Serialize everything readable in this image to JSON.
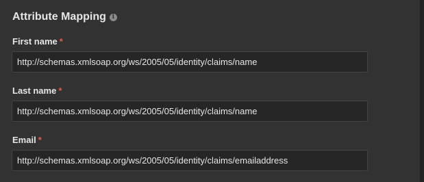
{
  "section": {
    "title": "Attribute Mapping",
    "info_icon": "info-icon"
  },
  "colors": {
    "panel_bg": "#323232",
    "input_bg": "#262626",
    "required_marker": "#e35a4f"
  },
  "fields": [
    {
      "label": "First name",
      "required_marker": "*",
      "value": "http://schemas.xmlsoap.org/ws/2005/05/identity/claims/name"
    },
    {
      "label": "Last name",
      "required_marker": "*",
      "value": "http://schemas.xmlsoap.org/ws/2005/05/identity/claims/name"
    },
    {
      "label": "Email",
      "required_marker": "*",
      "value": "http://schemas.xmlsoap.org/ws/2005/05/identity/claims/emailaddress"
    }
  ]
}
